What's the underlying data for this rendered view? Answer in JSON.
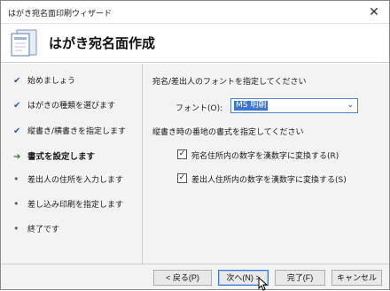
{
  "window": {
    "title": "はがき宛名面印刷ウィザード",
    "close_glyph": "✕"
  },
  "header": {
    "title": "はがき宛名面作成",
    "icon": "postcard-doc-icon"
  },
  "sidebar": {
    "steps": [
      {
        "label": "始めましょう",
        "state": "done",
        "mark": "✔"
      },
      {
        "label": "はがきの種類を選びます",
        "state": "done",
        "mark": "✔"
      },
      {
        "label": "縦書き/横書きを指定します",
        "state": "done",
        "mark": "✔"
      },
      {
        "label": "書式を設定します",
        "state": "current",
        "mark": "➔"
      },
      {
        "label": "差出人の住所を入力します",
        "state": "future",
        "mark": "•"
      },
      {
        "label": "差し込み印刷を指定します",
        "state": "future",
        "mark": "•"
      },
      {
        "label": "終了です",
        "state": "future",
        "mark": "•"
      }
    ]
  },
  "main": {
    "font_section": "宛名/差出人のフォントを指定してください",
    "font_label": "フォント(O):",
    "font_value": "MS 明朝",
    "vertical_section": "縦書き時の番地の書式を指定してください",
    "checkboxes": [
      {
        "label": "宛名住所内の数字を漢数字に変換する(R)",
        "checked": true
      },
      {
        "label": "差出人住所内の数字を漢数字に変換する(S)",
        "checked": true
      }
    ]
  },
  "footer": {
    "back": "< 戻る(P)",
    "next": "次へ(N) >",
    "finish": "完了(F)",
    "cancel": "キャンセル"
  }
}
